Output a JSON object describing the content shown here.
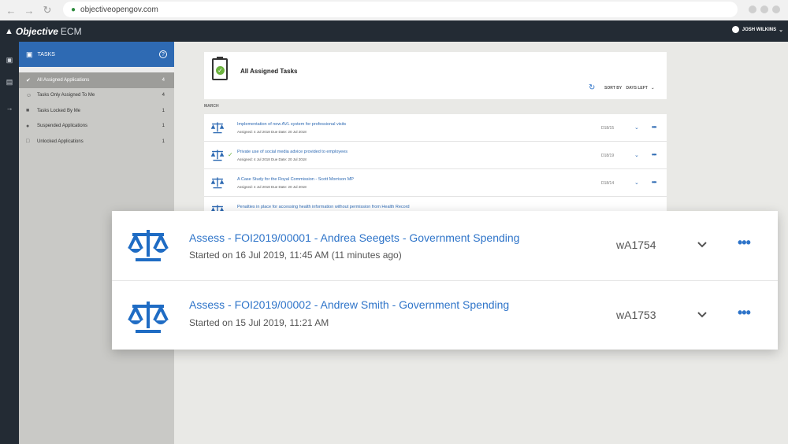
{
  "browser": {
    "url": "objectiveopengov.com",
    "icons": [
      "back-icon",
      "forward-icon",
      "reload-icon",
      "lock-icon"
    ]
  },
  "header": {
    "brand": "Objective",
    "product": "ECM",
    "user": "JOSH WILKINS"
  },
  "sidebar": {
    "title": "TASKS",
    "items": [
      {
        "label": "All Assigned Applications",
        "count": "4",
        "icon": "check-circle-icon",
        "active": true
      },
      {
        "label": "Tasks Only Assigned To Me",
        "count": "4",
        "icon": "person-icon",
        "active": false
      },
      {
        "label": "Tasks Locked By Me",
        "count": "1",
        "icon": "lock-icon",
        "active": false
      },
      {
        "label": "Suspended Applications",
        "count": "1",
        "icon": "pause-icon",
        "active": false
      },
      {
        "label": "Unlocked Applications",
        "count": "1",
        "icon": "unlock-icon",
        "active": false
      }
    ]
  },
  "main": {
    "title": "All Assigned Tasks",
    "sort_label": "SORT BY",
    "sort_value": "DAYS LEFT",
    "section": "MARCH",
    "tasks": [
      {
        "title": "Implementation of new AVL system for professional visits",
        "meta": "Assigned: 4 Jul 2018    Due Date: 20 Jul 2018",
        "code": "D18/15",
        "checked": false
      },
      {
        "title": "Private use of social media advice provided to employees",
        "meta": "Assigned: 4 Jul 2018    Due Date: 20 Jul 2018",
        "code": "D18/19",
        "checked": true
      },
      {
        "title": "A Case Study for the Royal Commission - Scott Morrison MP",
        "meta": "Assigned: 4 Jul 2018    Due Date: 20 Jul 2018",
        "code": "D18/14",
        "checked": false
      },
      {
        "title": "Penalties in place for accessing health information without permission from Health Record",
        "meta": "",
        "code": "",
        "checked": false
      }
    ]
  },
  "zoom": {
    "rows": [
      {
        "title": "Assess - FOI2019/00001 - Andrea Seegets - Government Spending",
        "sub": "Started on 16 Jul 2019, 11:45 AM (11 minutes ago)",
        "code": "wA1754"
      },
      {
        "title": "Assess - FOI2019/00002 - Andrew Smith - Government Spending",
        "sub": "Started on 15 Jul 2019, 11:21 AM",
        "code": "wA1753"
      }
    ]
  },
  "colors": {
    "accent": "#2e74c9",
    "header_bg": "#232b34",
    "sidebar_head": "#2e6ab3",
    "success": "#6db33f"
  }
}
